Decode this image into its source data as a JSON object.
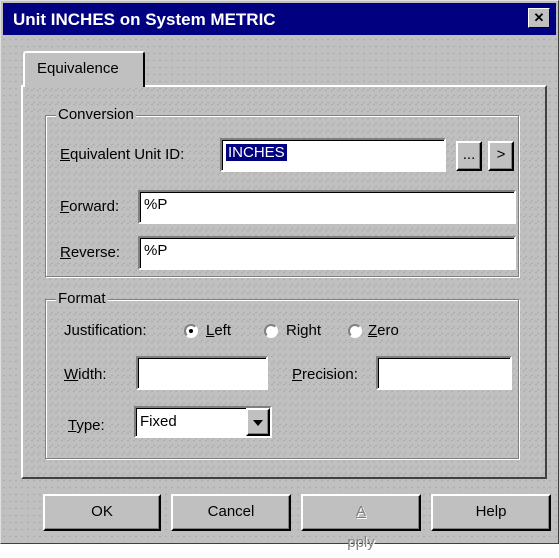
{
  "window": {
    "title": "Unit INCHES on System METRIC",
    "close_glyph": "✕"
  },
  "tabs": [
    {
      "label": "Equivalence"
    }
  ],
  "conversion": {
    "legend": "Conversion",
    "equiv_label_u": "E",
    "equiv_label_rest": "quivalent Unit ID:",
    "equiv_value": "INCHES",
    "browse_label": "...",
    "goto_label": ">",
    "forward_label_u": "F",
    "forward_label_rest": "orward:",
    "forward_value": "%P",
    "reverse_label_u": "R",
    "reverse_label_rest": "everse:",
    "reverse_value": "%P"
  },
  "format": {
    "legend": "Format",
    "justification_label": "Justification:",
    "radios": [
      {
        "u": "L",
        "rest": "eft",
        "checked": true
      },
      {
        "u": "",
        "pre": "Ri",
        "u2": "g",
        "post": "ht",
        "checked": false
      },
      {
        "u": "Z",
        "rest": "ero",
        "checked": false
      }
    ],
    "width_label_u": "W",
    "width_label_rest": "idth:",
    "width_value": "",
    "precision_label_u": "P",
    "precision_label_rest": "recision:",
    "precision_value": "",
    "type_label_u": "T",
    "type_label_rest": "ype:",
    "type_value": "Fixed"
  },
  "buttons": {
    "ok": "OK",
    "cancel": "Cancel",
    "apply_u": "A",
    "apply_rest": "pply",
    "help": "Help"
  }
}
